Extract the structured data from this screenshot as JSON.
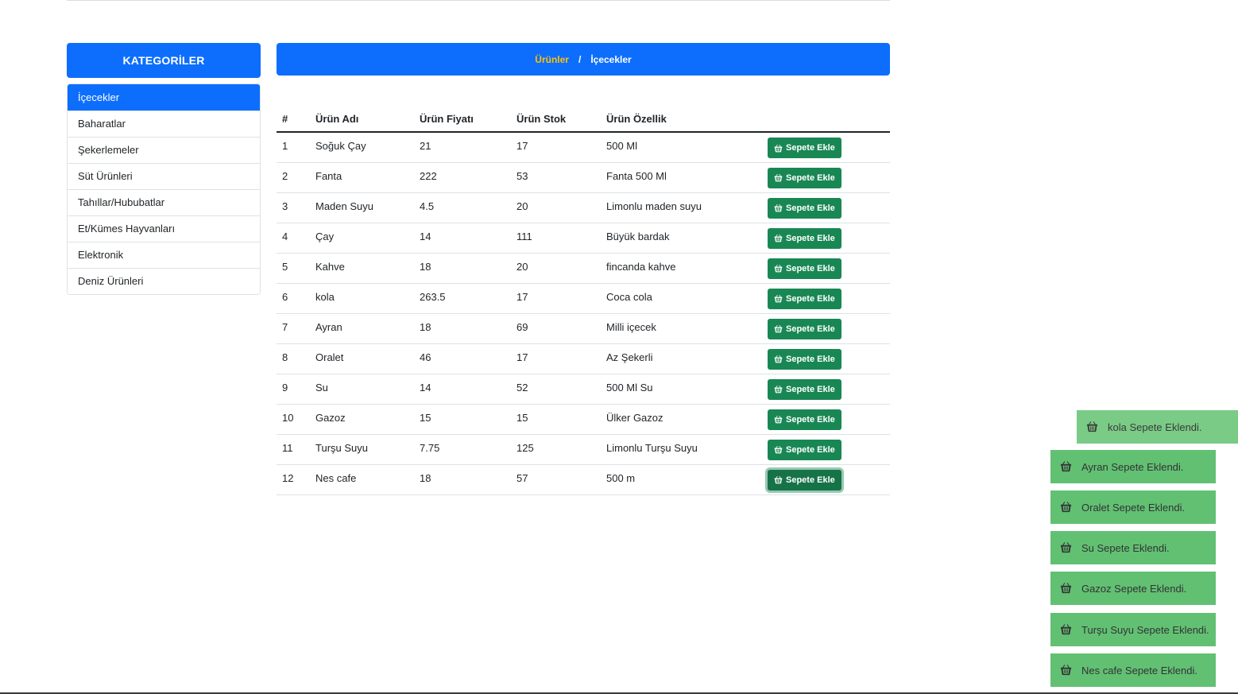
{
  "sidebar": {
    "title": "KATEGORİLER",
    "items": [
      {
        "label": "İçecekler",
        "active": true
      },
      {
        "label": "Baharatlar"
      },
      {
        "label": "Şekerlemeler"
      },
      {
        "label": "Süt Ürünleri"
      },
      {
        "label": "Tahıllar/Hububatlar"
      },
      {
        "label": "Et/Kümes Hayvanları"
      },
      {
        "label": "Elektronik"
      },
      {
        "label": "Deniz Ürünleri"
      }
    ]
  },
  "breadcrumb": {
    "parent": "Ürünler",
    "separator": "/",
    "current": "İçecekler"
  },
  "table": {
    "headers": [
      "#",
      "Ürün Adı",
      "Ürün Fiyatı",
      "Ürün Stok",
      "Ürün Özellik",
      ""
    ],
    "button_label": "Sepete Ekle",
    "rows": [
      {
        "id": "1",
        "name": "Soğuk Çay",
        "price": "21",
        "stock": "17",
        "feature": "500 Ml"
      },
      {
        "id": "2",
        "name": "Fanta",
        "price": "222",
        "stock": "53",
        "feature": "Fanta 500 Ml"
      },
      {
        "id": "3",
        "name": "Maden Suyu",
        "price": "4.5",
        "stock": "20",
        "feature": "Limonlu maden suyu"
      },
      {
        "id": "4",
        "name": "Çay",
        "price": "14",
        "stock": "111",
        "feature": "Büyük bardak"
      },
      {
        "id": "5",
        "name": "Kahve",
        "price": "18",
        "stock": "20",
        "feature": "fincanda kahve"
      },
      {
        "id": "6",
        "name": "kola",
        "price": "263.5",
        "stock": "17",
        "feature": "Coca cola"
      },
      {
        "id": "7",
        "name": "Ayran",
        "price": "18",
        "stock": "69",
        "feature": "Milli içecek"
      },
      {
        "id": "8",
        "name": "Oralet",
        "price": "46",
        "stock": "17",
        "feature": "Az Şekerli"
      },
      {
        "id": "9",
        "name": "Su",
        "price": "14",
        "stock": "52",
        "feature": "500 Ml Su"
      },
      {
        "id": "10",
        "name": "Gazoz",
        "price": "15",
        "stock": "15",
        "feature": "Ülker Gazoz"
      },
      {
        "id": "11",
        "name": "Turşu Suyu",
        "price": "7.75",
        "stock": "125",
        "feature": "Limonlu Turşu Suyu"
      },
      {
        "id": "12",
        "name": "Nes cafe",
        "price": "18",
        "stock": "57",
        "feature": "500 m"
      }
    ]
  },
  "toasts": [
    "kola Sepete Eklendi.",
    "Ayran Sepete Eklendi.",
    "Oralet Sepete Eklendi.",
    "Su Sepete Eklendi.",
    "Gazoz Sepete Eklendi.",
    "Turşu Suyu Sepete Eklendi.",
    "Nes cafe Sepete Eklendi."
  ],
  "icons": {
    "button": "basket-icon",
    "toast": "basket-icon"
  },
  "colors": {
    "primary": "#0d6efd",
    "breadcrumb_link": "#ffc107",
    "button": "#198754",
    "toast": "#62c073"
  }
}
